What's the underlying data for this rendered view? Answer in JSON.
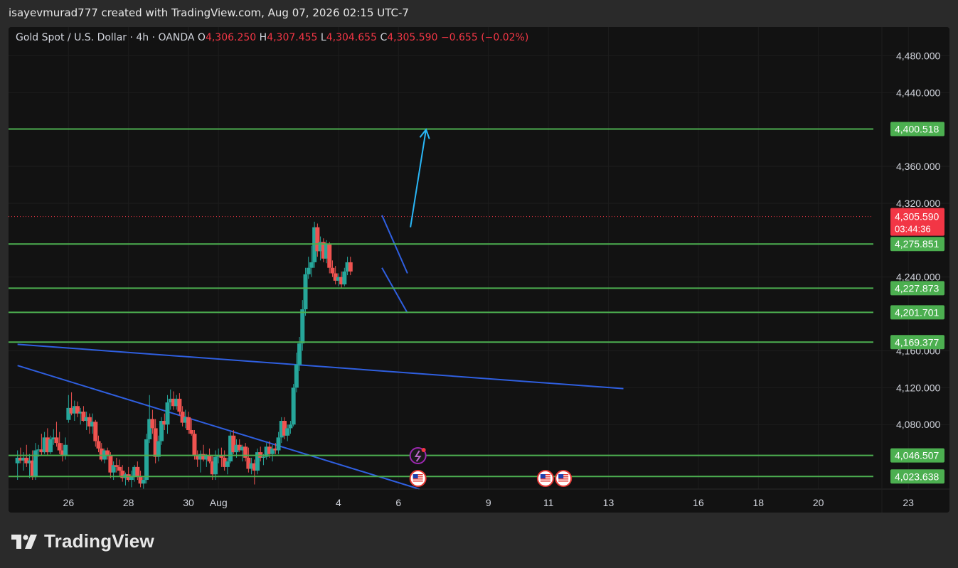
{
  "header": {
    "attribution": "isayevmurad777 created with TradingView.com, Aug 07, 2026 02:15 UTC-7"
  },
  "legend": {
    "symbol": "Gold Spot / U.S. Dollar · 4h · OANDA",
    "o_label": "O",
    "o_value": "4,306.250",
    "h_label": "H",
    "h_value": "4,307.455",
    "l_label": "L",
    "l_value": "4,304.655",
    "c_label": "C",
    "c_value": "4,305.590",
    "change": "−0.655 (−0.02%)"
  },
  "brand": {
    "name": "TradingView"
  },
  "colors": {
    "up": "#26a69a",
    "down": "#ef5350",
    "level_line": "#4caf50",
    "trend_line": "#2f5fe0",
    "arrow": "#29b6f6",
    "price_badge": "#f23645",
    "panel": "#121212"
  },
  "chart_data": {
    "type": "candlestick",
    "symbol": "Gold Spot / U.S. Dollar",
    "interval": "4h",
    "broker": "OANDA",
    "ylim": [
      4010,
      4505
    ],
    "y_ticks": [
      "4,080.000",
      "4,120.000",
      "4,160.000",
      "4,240.000",
      "4,320.000",
      "4,360.000",
      "4,440.000",
      "4,480.000"
    ],
    "x_ticks": [
      {
        "label": "26",
        "t": 26
      },
      {
        "label": "28",
        "t": 28
      },
      {
        "label": "30",
        "t": 30
      },
      {
        "label": "Aug",
        "t": 31
      },
      {
        "label": "4",
        "t": 35
      },
      {
        "label": "6",
        "t": 37
      },
      {
        "label": "9",
        "t": 40
      },
      {
        "label": "11",
        "t": 42
      },
      {
        "label": "13",
        "t": 44
      },
      {
        "label": "16",
        "t": 47
      },
      {
        "label": "18",
        "t": 49
      },
      {
        "label": "20",
        "t": 51
      },
      {
        "label": "23",
        "t": 54
      }
    ],
    "level_lines": [
      {
        "price": 4400.518,
        "label": "4,400.518"
      },
      {
        "price": 4275.851,
        "label": "4,275.851"
      },
      {
        "price": 4227.873,
        "label": "4,227.873"
      },
      {
        "price": 4201.701,
        "label": "4,201.701"
      },
      {
        "price": 4169.377,
        "label": "4,169.377"
      },
      {
        "price": 4046.507,
        "label": "4,046.507"
      },
      {
        "price": 4023.638,
        "label": "4,023.638"
      }
    ],
    "last_price": {
      "price": 4305.59,
      "label": "4,305.590",
      "countdown": "03:44:36"
    },
    "trend_lines": [
      {
        "t1": 24.3,
        "p1": 4167,
        "t2": 44.5,
        "p2": 4119
      },
      {
        "t1": 24.3,
        "p1": 4144,
        "t2": 37.7,
        "p2": 4010
      }
    ],
    "flag_lines": [
      {
        "t1": 36.45,
        "p1": 4307,
        "t2": 37.3,
        "p2": 4244
      },
      {
        "t1": 36.45,
        "p1": 4250,
        "t2": 37.3,
        "p2": 4201
      }
    ],
    "projection_arrow": {
      "t1": 37.4,
      "p1": 4294,
      "t2": 37.92,
      "p2": 4400
    },
    "event_markers": [
      {
        "t": 37.65,
        "type": "lightning"
      },
      {
        "t": 37.65,
        "type": "us-flag"
      },
      {
        "t": 41.9,
        "type": "us-flag"
      },
      {
        "t": 42.5,
        "type": "us-flag"
      }
    ],
    "candles": [
      {
        "t": 24.3,
        "o": 4038,
        "h": 4052,
        "l": 4020,
        "c": 4044
      },
      {
        "t": 24.4,
        "o": 4044,
        "h": 4055,
        "l": 4038,
        "c": 4041
      },
      {
        "t": 24.5,
        "o": 4041,
        "h": 4050,
        "l": 4030,
        "c": 4044
      },
      {
        "t": 24.6,
        "o": 4044,
        "h": 4058,
        "l": 4034,
        "c": 4038
      },
      {
        "t": 24.7,
        "o": 4038,
        "h": 4048,
        "l": 4022,
        "c": 4041
      },
      {
        "t": 24.8,
        "o": 4041,
        "h": 4052,
        "l": 4020,
        "c": 4023
      },
      {
        "t": 24.9,
        "o": 4023,
        "h": 4060,
        "l": 4020,
        "c": 4052
      },
      {
        "t": 25.0,
        "o": 4052,
        "h": 4058,
        "l": 4045,
        "c": 4053
      },
      {
        "t": 25.1,
        "o": 4053,
        "h": 4070,
        "l": 4047,
        "c": 4050
      },
      {
        "t": 25.2,
        "o": 4050,
        "h": 4072,
        "l": 4048,
        "c": 4066
      },
      {
        "t": 25.3,
        "o": 4066,
        "h": 4076,
        "l": 4046,
        "c": 4050
      },
      {
        "t": 25.4,
        "o": 4050,
        "h": 4068,
        "l": 4048,
        "c": 4064
      },
      {
        "t": 25.5,
        "o": 4064,
        "h": 4075,
        "l": 4058,
        "c": 4066
      },
      {
        "t": 25.6,
        "o": 4066,
        "h": 4083,
        "l": 4056,
        "c": 4060
      },
      {
        "t": 25.7,
        "o": 4060,
        "h": 4072,
        "l": 4048,
        "c": 4052
      },
      {
        "t": 25.8,
        "o": 4052,
        "h": 4060,
        "l": 4040,
        "c": 4046
      },
      {
        "t": 25.9,
        "o": 4046,
        "h": 4066,
        "l": 4042,
        "c": 4058
      },
      {
        "t": 26.0,
        "o": 4085,
        "h": 4112,
        "l": 4082,
        "c": 4098
      },
      {
        "t": 26.1,
        "o": 4098,
        "h": 4115,
        "l": 4090,
        "c": 4092
      },
      {
        "t": 26.2,
        "o": 4092,
        "h": 4106,
        "l": 4084,
        "c": 4100
      },
      {
        "t": 26.3,
        "o": 4100,
        "h": 4105,
        "l": 4088,
        "c": 4092
      },
      {
        "t": 26.4,
        "o": 4092,
        "h": 4098,
        "l": 4080,
        "c": 4094
      },
      {
        "t": 26.5,
        "o": 4094,
        "h": 4100,
        "l": 4083,
        "c": 4084
      },
      {
        "t": 26.6,
        "o": 4084,
        "h": 4094,
        "l": 4074,
        "c": 4088
      },
      {
        "t": 26.7,
        "o": 4088,
        "h": 4092,
        "l": 4070,
        "c": 4078
      },
      {
        "t": 26.8,
        "o": 4078,
        "h": 4092,
        "l": 4070,
        "c": 4083
      },
      {
        "t": 26.9,
        "o": 4083,
        "h": 4085,
        "l": 4056,
        "c": 4062
      },
      {
        "t": 27.0,
        "o": 4062,
        "h": 4068,
        "l": 4050,
        "c": 4054
      },
      {
        "t": 27.1,
        "o": 4054,
        "h": 4060,
        "l": 4040,
        "c": 4042
      },
      {
        "t": 27.2,
        "o": 4042,
        "h": 4054,
        "l": 4038,
        "c": 4052
      },
      {
        "t": 27.3,
        "o": 4052,
        "h": 4055,
        "l": 4042,
        "c": 4046
      },
      {
        "t": 27.4,
        "o": 4046,
        "h": 4050,
        "l": 4022,
        "c": 4028
      },
      {
        "t": 27.5,
        "o": 4028,
        "h": 4040,
        "l": 4020,
        "c": 4036
      },
      {
        "t": 27.6,
        "o": 4036,
        "h": 4044,
        "l": 4028,
        "c": 4034
      },
      {
        "t": 27.7,
        "o": 4034,
        "h": 4042,
        "l": 4024,
        "c": 4030
      },
      {
        "t": 27.8,
        "o": 4030,
        "h": 4036,
        "l": 4018,
        "c": 4022
      },
      {
        "t": 27.9,
        "o": 4022,
        "h": 4028,
        "l": 4014,
        "c": 4026
      },
      {
        "t": 28.0,
        "o": 4026,
        "h": 4034,
        "l": 4018,
        "c": 4020
      },
      {
        "t": 28.1,
        "o": 4020,
        "h": 4030,
        "l": 4012,
        "c": 4024
      },
      {
        "t": 28.2,
        "o": 4024,
        "h": 4036,
        "l": 4018,
        "c": 4034
      },
      {
        "t": 28.3,
        "o": 4034,
        "h": 4040,
        "l": 4020,
        "c": 4024
      },
      {
        "t": 28.4,
        "o": 4024,
        "h": 4030,
        "l": 4012,
        "c": 4016
      },
      {
        "t": 28.5,
        "o": 4016,
        "h": 4024,
        "l": 4010,
        "c": 4020
      },
      {
        "t": 28.6,
        "o": 4020,
        "h": 4070,
        "l": 4016,
        "c": 4064
      },
      {
        "t": 28.7,
        "o": 4064,
        "h": 4112,
        "l": 4060,
        "c": 4086
      },
      {
        "t": 28.8,
        "o": 4086,
        "h": 4096,
        "l": 4070,
        "c": 4076
      },
      {
        "t": 28.9,
        "o": 4076,
        "h": 4086,
        "l": 4038,
        "c": 4045
      },
      {
        "t": 29.0,
        "o": 4045,
        "h": 4068,
        "l": 4040,
        "c": 4062
      },
      {
        "t": 29.1,
        "o": 4062,
        "h": 4088,
        "l": 4058,
        "c": 4084
      },
      {
        "t": 29.2,
        "o": 4084,
        "h": 4092,
        "l": 4074,
        "c": 4080
      },
      {
        "t": 29.3,
        "o": 4080,
        "h": 4112,
        "l": 4070,
        "c": 4104
      },
      {
        "t": 29.4,
        "o": 4104,
        "h": 4118,
        "l": 4096,
        "c": 4108
      },
      {
        "t": 29.5,
        "o": 4108,
        "h": 4116,
        "l": 4096,
        "c": 4100
      },
      {
        "t": 29.6,
        "o": 4100,
        "h": 4112,
        "l": 4096,
        "c": 4108
      },
      {
        "t": 29.7,
        "o": 4108,
        "h": 4114,
        "l": 4090,
        "c": 4094
      },
      {
        "t": 29.8,
        "o": 4094,
        "h": 4100,
        "l": 4078,
        "c": 4082
      },
      {
        "t": 29.9,
        "o": 4082,
        "h": 4096,
        "l": 4076,
        "c": 4088
      },
      {
        "t": 30.0,
        "o": 4088,
        "h": 4094,
        "l": 4070,
        "c": 4074
      },
      {
        "t": 30.1,
        "o": 4074,
        "h": 4086,
        "l": 4068,
        "c": 4070
      },
      {
        "t": 30.2,
        "o": 4070,
        "h": 4074,
        "l": 4042,
        "c": 4046
      },
      {
        "t": 30.3,
        "o": 4046,
        "h": 4052,
        "l": 4034,
        "c": 4042
      },
      {
        "t": 30.4,
        "o": 4042,
        "h": 4052,
        "l": 4028,
        "c": 4048
      },
      {
        "t": 30.5,
        "o": 4048,
        "h": 4058,
        "l": 4040,
        "c": 4042
      },
      {
        "t": 30.6,
        "o": 4042,
        "h": 4048,
        "l": 4034,
        "c": 4046
      },
      {
        "t": 30.7,
        "o": 4046,
        "h": 4054,
        "l": 4038,
        "c": 4040
      },
      {
        "t": 30.8,
        "o": 4040,
        "h": 4046,
        "l": 4020,
        "c": 4026
      },
      {
        "t": 30.9,
        "o": 4026,
        "h": 4052,
        "l": 4020,
        "c": 4045
      },
      {
        "t": 31.0,
        "o": 4045,
        "h": 4054,
        "l": 4038,
        "c": 4047
      },
      {
        "t": 31.1,
        "o": 4047,
        "h": 4055,
        "l": 4034,
        "c": 4044
      },
      {
        "t": 31.2,
        "o": 4044,
        "h": 4052,
        "l": 4030,
        "c": 4034
      },
      {
        "t": 31.3,
        "o": 4034,
        "h": 4044,
        "l": 4026,
        "c": 4040
      },
      {
        "t": 31.4,
        "o": 4040,
        "h": 4072,
        "l": 4038,
        "c": 4068
      },
      {
        "t": 31.5,
        "o": 4068,
        "h": 4074,
        "l": 4048,
        "c": 4050
      },
      {
        "t": 31.6,
        "o": 4050,
        "h": 4064,
        "l": 4044,
        "c": 4058
      },
      {
        "t": 31.7,
        "o": 4058,
        "h": 4064,
        "l": 4050,
        "c": 4052
      },
      {
        "t": 31.8,
        "o": 4052,
        "h": 4058,
        "l": 4040,
        "c": 4056
      },
      {
        "t": 31.9,
        "o": 4056,
        "h": 4060,
        "l": 4040,
        "c": 4044
      },
      {
        "t": 32.0,
        "o": 4044,
        "h": 4055,
        "l": 4028,
        "c": 4032
      },
      {
        "t": 32.1,
        "o": 4032,
        "h": 4044,
        "l": 4026,
        "c": 4038
      },
      {
        "t": 32.2,
        "o": 4038,
        "h": 4042,
        "l": 4015,
        "c": 4030
      },
      {
        "t": 32.3,
        "o": 4030,
        "h": 4054,
        "l": 4026,
        "c": 4050
      },
      {
        "t": 32.4,
        "o": 4050,
        "h": 4056,
        "l": 4040,
        "c": 4044
      },
      {
        "t": 32.5,
        "o": 4044,
        "h": 4048,
        "l": 4036,
        "c": 4045
      },
      {
        "t": 32.6,
        "o": 4045,
        "h": 4060,
        "l": 4042,
        "c": 4056
      },
      {
        "t": 32.7,
        "o": 4056,
        "h": 4062,
        "l": 4044,
        "c": 4048
      },
      {
        "t": 32.8,
        "o": 4048,
        "h": 4058,
        "l": 4040,
        "c": 4054
      },
      {
        "t": 32.9,
        "o": 4054,
        "h": 4060,
        "l": 4048,
        "c": 4052
      },
      {
        "t": 33.0,
        "o": 4052,
        "h": 4072,
        "l": 4048,
        "c": 4066
      },
      {
        "t": 33.1,
        "o": 4066,
        "h": 4088,
        "l": 4060,
        "c": 4084
      },
      {
        "t": 33.2,
        "o": 4084,
        "h": 4088,
        "l": 4064,
        "c": 4068
      },
      {
        "t": 33.3,
        "o": 4068,
        "h": 4080,
        "l": 4062,
        "c": 4076
      },
      {
        "t": 33.4,
        "o": 4076,
        "h": 4084,
        "l": 4070,
        "c": 4080
      },
      {
        "t": 33.5,
        "o": 4080,
        "h": 4124,
        "l": 4078,
        "c": 4120
      },
      {
        "t": 33.6,
        "o": 4120,
        "h": 4158,
        "l": 4115,
        "c": 4145
      },
      {
        "t": 33.7,
        "o": 4145,
        "h": 4175,
        "l": 4138,
        "c": 4168
      },
      {
        "t": 33.8,
        "o": 4168,
        "h": 4215,
        "l": 4160,
        "c": 4205
      },
      {
        "t": 33.9,
        "o": 4205,
        "h": 4250,
        "l": 4198,
        "c": 4243
      },
      {
        "t": 34.0,
        "o": 4243,
        "h": 4262,
        "l": 4238,
        "c": 4250
      },
      {
        "t": 34.1,
        "o": 4250,
        "h": 4274,
        "l": 4240,
        "c": 4256
      },
      {
        "t": 34.2,
        "o": 4256,
        "h": 4300,
        "l": 4250,
        "c": 4294
      },
      {
        "t": 34.3,
        "o": 4294,
        "h": 4298,
        "l": 4262,
        "c": 4268
      },
      {
        "t": 34.4,
        "o": 4268,
        "h": 4284,
        "l": 4258,
        "c": 4278
      },
      {
        "t": 34.5,
        "o": 4278,
        "h": 4282,
        "l": 4256,
        "c": 4260
      },
      {
        "t": 34.6,
        "o": 4260,
        "h": 4280,
        "l": 4255,
        "c": 4276
      },
      {
        "t": 34.7,
        "o": 4276,
        "h": 4278,
        "l": 4244,
        "c": 4250
      },
      {
        "t": 34.8,
        "o": 4250,
        "h": 4258,
        "l": 4240,
        "c": 4244
      },
      {
        "t": 34.9,
        "o": 4244,
        "h": 4252,
        "l": 4232,
        "c": 4236
      },
      {
        "t": 35.0,
        "o": 4236,
        "h": 4244,
        "l": 4230,
        "c": 4240
      },
      {
        "t": 35.1,
        "o": 4240,
        "h": 4246,
        "l": 4228,
        "c": 4232
      },
      {
        "t": 35.2,
        "o": 4232,
        "h": 4250,
        "l": 4230,
        "c": 4246
      },
      {
        "t": 35.3,
        "o": 4246,
        "h": 4262,
        "l": 4242,
        "c": 4256
      },
      {
        "t": 35.4,
        "o": 4256,
        "h": 4262,
        "l": 4242,
        "c": 4246
      }
    ]
  }
}
